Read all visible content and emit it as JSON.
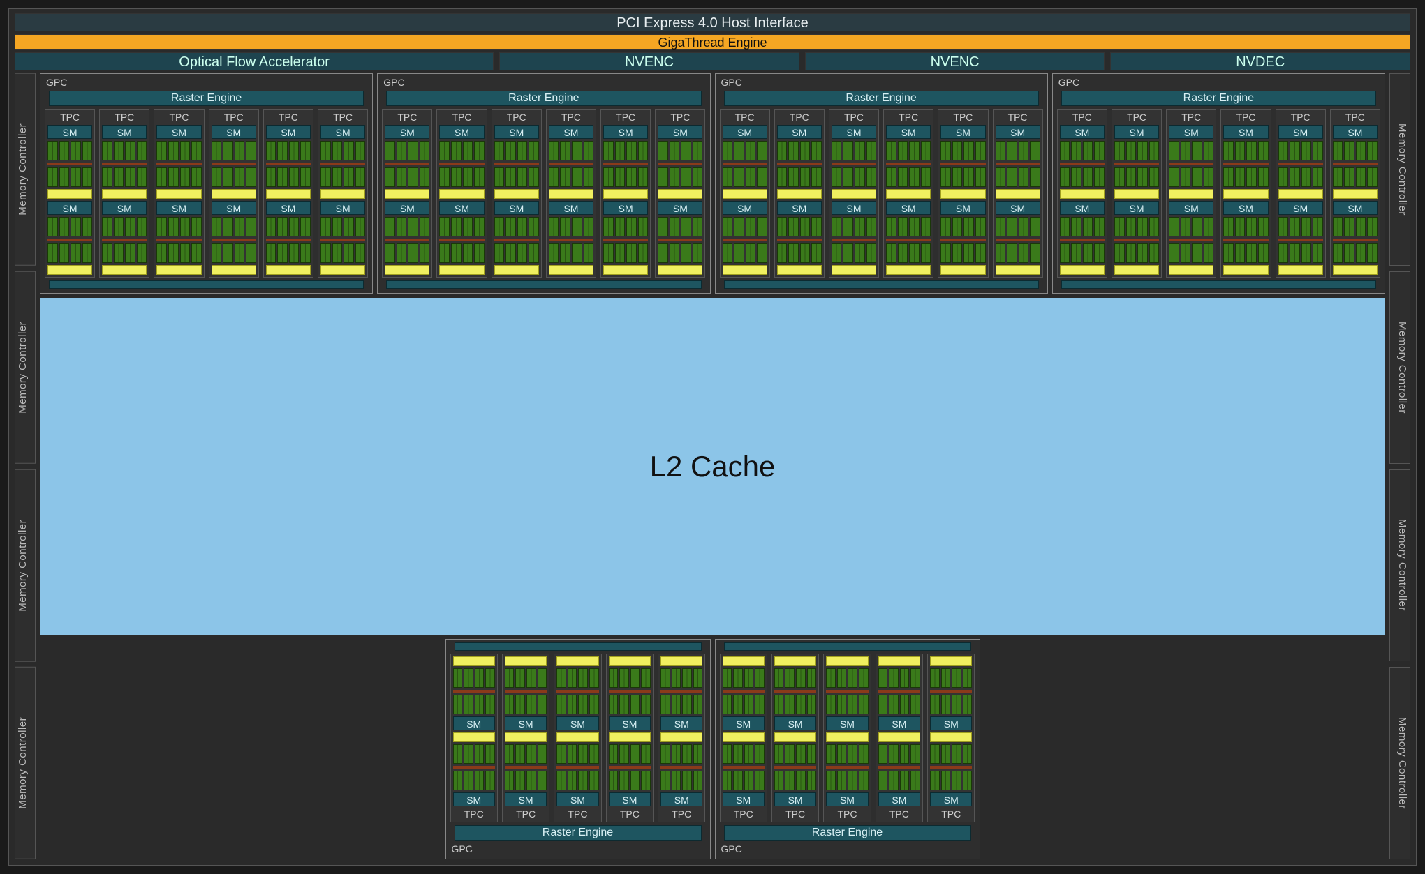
{
  "top": {
    "pcie": "PCI Express 4.0 Host Interface",
    "giga": "GigaThread Engine",
    "ofa": "Optical Flow Accelerator",
    "nvenc": "NVENC",
    "nvdec": "NVDEC"
  },
  "mc": "Memory Controller",
  "gpc": {
    "label": "GPC",
    "raster": "Raster Engine",
    "tpc": "TPC",
    "sm": "SM"
  },
  "l2": "L2 Cache",
  "structure": {
    "top_gpcs": 4,
    "top_gpc_tpcs": 6,
    "bottom_gpcs": 2,
    "bottom_gpc_tpcs": 5,
    "sms_per_tpc": 2,
    "mem_controllers_per_side": 4
  }
}
